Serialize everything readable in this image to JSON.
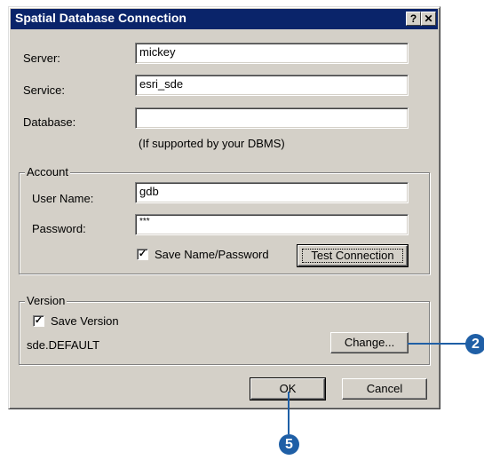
{
  "window": {
    "title": "Spatial Database Connection",
    "help_button": "?",
    "close_button": "✕"
  },
  "connection": {
    "server_label": "Server:",
    "server_value": "mickey",
    "service_label": "Service:",
    "service_value": "esri_sde",
    "database_label": "Database:",
    "database_value": "",
    "database_hint": "(If supported by your DBMS)"
  },
  "account": {
    "group_label": "Account",
    "username_label": "User Name:",
    "username_value": "gdb",
    "password_label": "Password:",
    "password_value": "***",
    "save_checkbox_label": "Save Name/Password",
    "save_checked": true,
    "test_button": "Test Connection"
  },
  "version": {
    "group_label": "Version",
    "save_checkbox_label": "Save Version",
    "save_checked": true,
    "current_version": "sde.DEFAULT",
    "change_button": "Change..."
  },
  "footer": {
    "ok_button": "OK",
    "cancel_button": "Cancel"
  },
  "callouts": {
    "change_step": "2",
    "ok_step": "5",
    "color": "#1f5fa6"
  }
}
